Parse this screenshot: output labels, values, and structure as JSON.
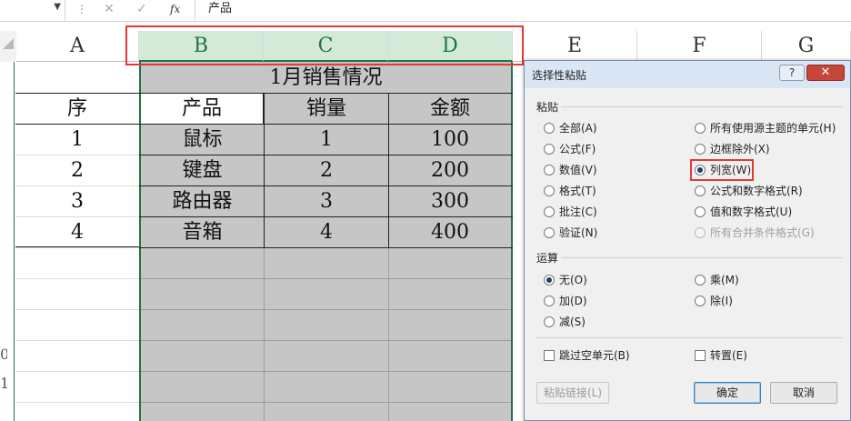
{
  "formula_bar": {
    "cell_value": "产品",
    "fx_label": "fx",
    "cancel_glyph": "✕",
    "enter_glyph": "✓",
    "dropdown_glyph": "▼",
    "sep_glyph": "⋮"
  },
  "columns": [
    "A",
    "B",
    "C",
    "D",
    "E",
    "F",
    "G"
  ],
  "row_headers": [
    "0",
    "1"
  ],
  "sheet": {
    "title": "1月销售情况",
    "headers": [
      "序",
      "产品",
      "销量",
      "金额"
    ],
    "rows": [
      [
        "1",
        "鼠标",
        "1",
        "100"
      ],
      [
        "2",
        "键盘",
        "2",
        "200"
      ],
      [
        "3",
        "路由器",
        "3",
        "300"
      ],
      [
        "4",
        "音箱",
        "4",
        "400"
      ]
    ]
  },
  "dialog": {
    "title": "选择性粘贴",
    "help_glyph": "?",
    "close_glyph": "✕",
    "paste_group_label": "粘贴",
    "paste_left": [
      {
        "label": "全部(A)",
        "selected": false
      },
      {
        "label": "公式(F)",
        "selected": false
      },
      {
        "label": "数值(V)",
        "selected": false
      },
      {
        "label": "格式(T)",
        "selected": false
      },
      {
        "label": "批注(C)",
        "selected": false
      },
      {
        "label": "验证(N)",
        "selected": false
      }
    ],
    "paste_right": [
      {
        "label": "所有使用源主题的单元(H)",
        "selected": false
      },
      {
        "label": "边框除外(X)",
        "selected": false
      },
      {
        "label": "列宽(W)",
        "selected": true
      },
      {
        "label": "公式和数字格式(R)",
        "selected": false
      },
      {
        "label": "值和数字格式(U)",
        "selected": false
      },
      {
        "label": "所有合并条件格式(G)",
        "selected": false,
        "disabled": true
      }
    ],
    "operation_group_label": "运算",
    "operation_left": [
      {
        "label": "无(O)",
        "selected": true
      },
      {
        "label": "加(D)",
        "selected": false
      },
      {
        "label": "减(S)",
        "selected": false
      }
    ],
    "operation_right": [
      {
        "label": "乘(M)",
        "selected": false
      },
      {
        "label": "除(I)",
        "selected": false
      }
    ],
    "skip_blanks_label": "跳过空单元(B)",
    "transpose_label": "转置(E)",
    "paste_link_label": "粘贴链接(L)",
    "ok_label": "确定",
    "cancel_label": "取消"
  },
  "colors": {
    "accent_green": "#217346",
    "selection_fill": "#c6c6c6",
    "header_selected": "#d3ead9",
    "highlight_red": "#e53935"
  }
}
